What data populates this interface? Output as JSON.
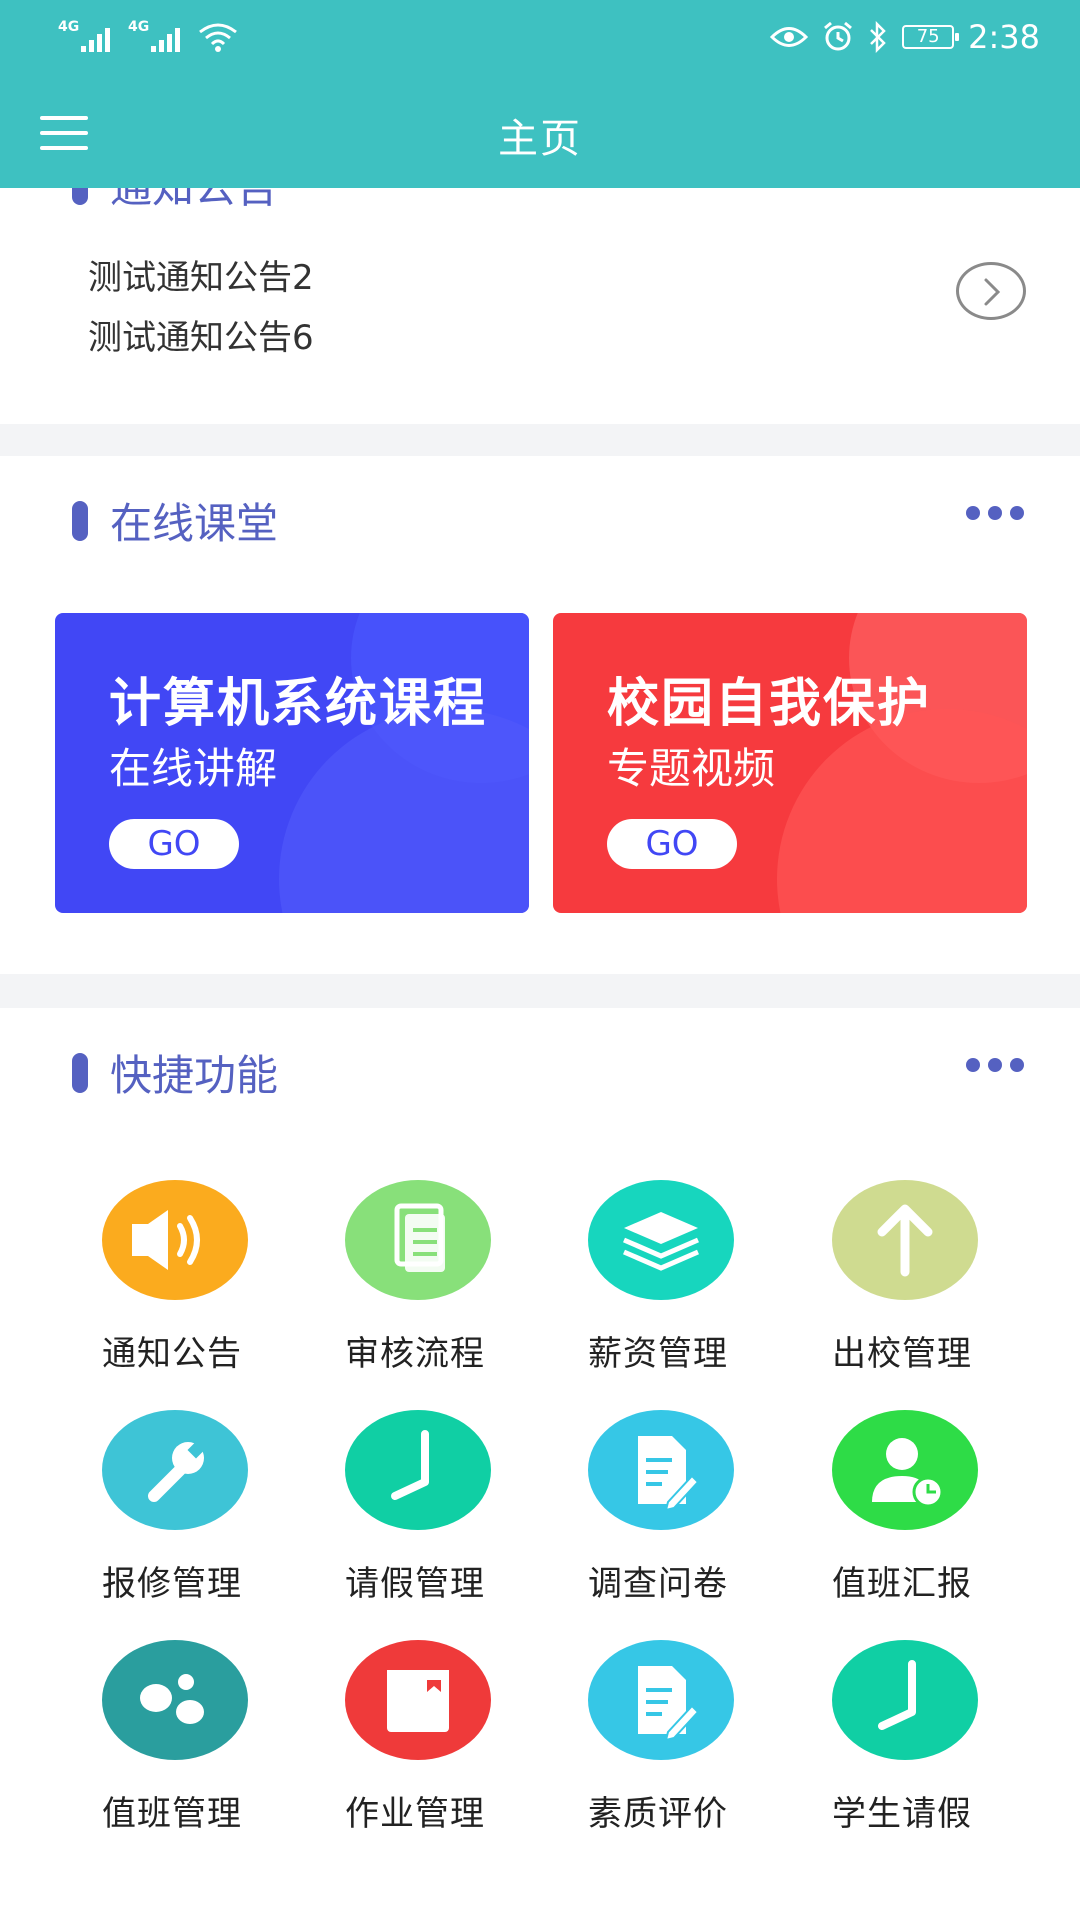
{
  "status_bar": {
    "sim1": "4G",
    "sim2": "4G",
    "battery": "75",
    "time": "2:38"
  },
  "nav": {
    "title": "主页"
  },
  "notice": {
    "title": "通知公告",
    "items": [
      "测试通知公告2",
      "测试通知公告6"
    ]
  },
  "online_class": {
    "title": "在线课堂",
    "banners": [
      {
        "title": "计算机系统课程",
        "subtitle": "在线讲解",
        "go": "GO"
      },
      {
        "title": "校园自我保护",
        "subtitle": "专题视频",
        "go": "GO"
      }
    ]
  },
  "quick": {
    "title": "快捷功能",
    "items": [
      {
        "label": "通知公告",
        "icon": "speaker-icon",
        "color": "#fbab1e"
      },
      {
        "label": "审核流程",
        "icon": "documents-icon",
        "color": "#88e07a"
      },
      {
        "label": "薪资管理",
        "icon": "layers-icon",
        "color": "#17d6be"
      },
      {
        "label": "出校管理",
        "icon": "arrow-up-icon",
        "color": "#cfdb90"
      },
      {
        "label": "报修管理",
        "icon": "wrench-icon",
        "color": "#3ec4d6"
      },
      {
        "label": "请假管理",
        "icon": "clock-icon",
        "color": "#10cfa4"
      },
      {
        "label": "调查问卷",
        "icon": "edit-document-icon",
        "color": "#36c7e6"
      },
      {
        "label": "值班汇报",
        "icon": "user-clock-icon",
        "color": "#2edc47"
      },
      {
        "label": "值班管理",
        "icon": "dots-icon",
        "color": "#2a9e9e"
      },
      {
        "label": "作业管理",
        "icon": "notebook-icon",
        "color": "#ef3a3a"
      },
      {
        "label": "素质评价",
        "icon": "edit-document-icon",
        "color": "#36c7e6"
      },
      {
        "label": "学生请假",
        "icon": "clock-icon",
        "color": "#10cfa4"
      }
    ]
  },
  "colors": {
    "header": "#3ec1c1",
    "accent": "#5561c1"
  }
}
